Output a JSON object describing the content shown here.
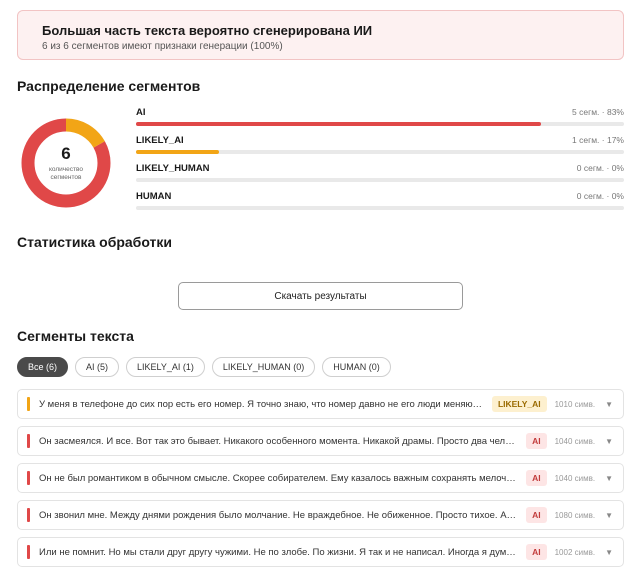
{
  "banner": {
    "title": "Большая часть текста вероятно сгенерирована ИИ",
    "subtitle": "6 из 6 сегментов имеют признаки генерации (100%)"
  },
  "distribution": {
    "heading": "Распределение сегментов",
    "donut": {
      "total": "6",
      "caption": "количество сегментов"
    },
    "rows": [
      {
        "label": "AI",
        "count": "5 сегм. · 83%",
        "fraction": 0.83,
        "color": "#e04848"
      },
      {
        "label": "LIKELY_AI",
        "count": "1 сегм. · 17%",
        "fraction": 0.17,
        "color": "#f2a516"
      },
      {
        "label": "LIKELY_HUMAN",
        "count": "0 сегм. · 0%",
        "fraction": 0,
        "color": "#9ccc65"
      },
      {
        "label": "HUMAN",
        "count": "0 сегм. · 0%",
        "fraction": 0,
        "color": "#43a047"
      }
    ]
  },
  "stats": {
    "heading": "Статистика обработки"
  },
  "download": {
    "label": "Скачать результаты"
  },
  "segments": {
    "heading": "Сегменты текста",
    "filters": [
      {
        "label": "Все (6)",
        "active": true
      },
      {
        "label": "AI (5)",
        "active": false
      },
      {
        "label": "LIKELY_AI (1)",
        "active": false
      },
      {
        "label": "LIKELY_HUMAN (0)",
        "active": false
      },
      {
        "label": "HUMAN (0)",
        "active": false
      }
    ],
    "items": [
      {
        "text": "У меня в телефоне до сих пор есть его номер. Я точно знаю, что номер давно не его люди меняют телефоны",
        "badge": "LIKELY_AI",
        "length": "1010 симв.",
        "color": "#f2a516"
      },
      {
        "text": "Он засмеялся. И все. Вот так это бывает. Никакого особенного момента. Никакой драмы. Просто два человека",
        "badge": "AI",
        "length": "1040 симв.",
        "color": "#e04848"
      },
      {
        "text": "Он не был романтиком в обычном смысле. Скорее собирателем. Ему казалось важным сохранять мелочи, в которых",
        "badge": "AI",
        "length": "1040 симв.",
        "color": "#e04848"
      },
      {
        "text": "Он звонил мне. Между днями рождения было молчание. Не враждебное. Не обиженное. Просто тихое. А потом",
        "badge": "AI",
        "length": "1080 симв.",
        "color": "#e04848"
      },
      {
        "text": "Или не помнит. Но мы стали друг другу чужими. Не по злобе. По жизни. Я так и не написал. Иногда я думаю",
        "badge": "AI",
        "length": "1002 симв.",
        "color": "#e04848"
      }
    ]
  },
  "icons": {
    "expand": "chevron-down-icon"
  }
}
